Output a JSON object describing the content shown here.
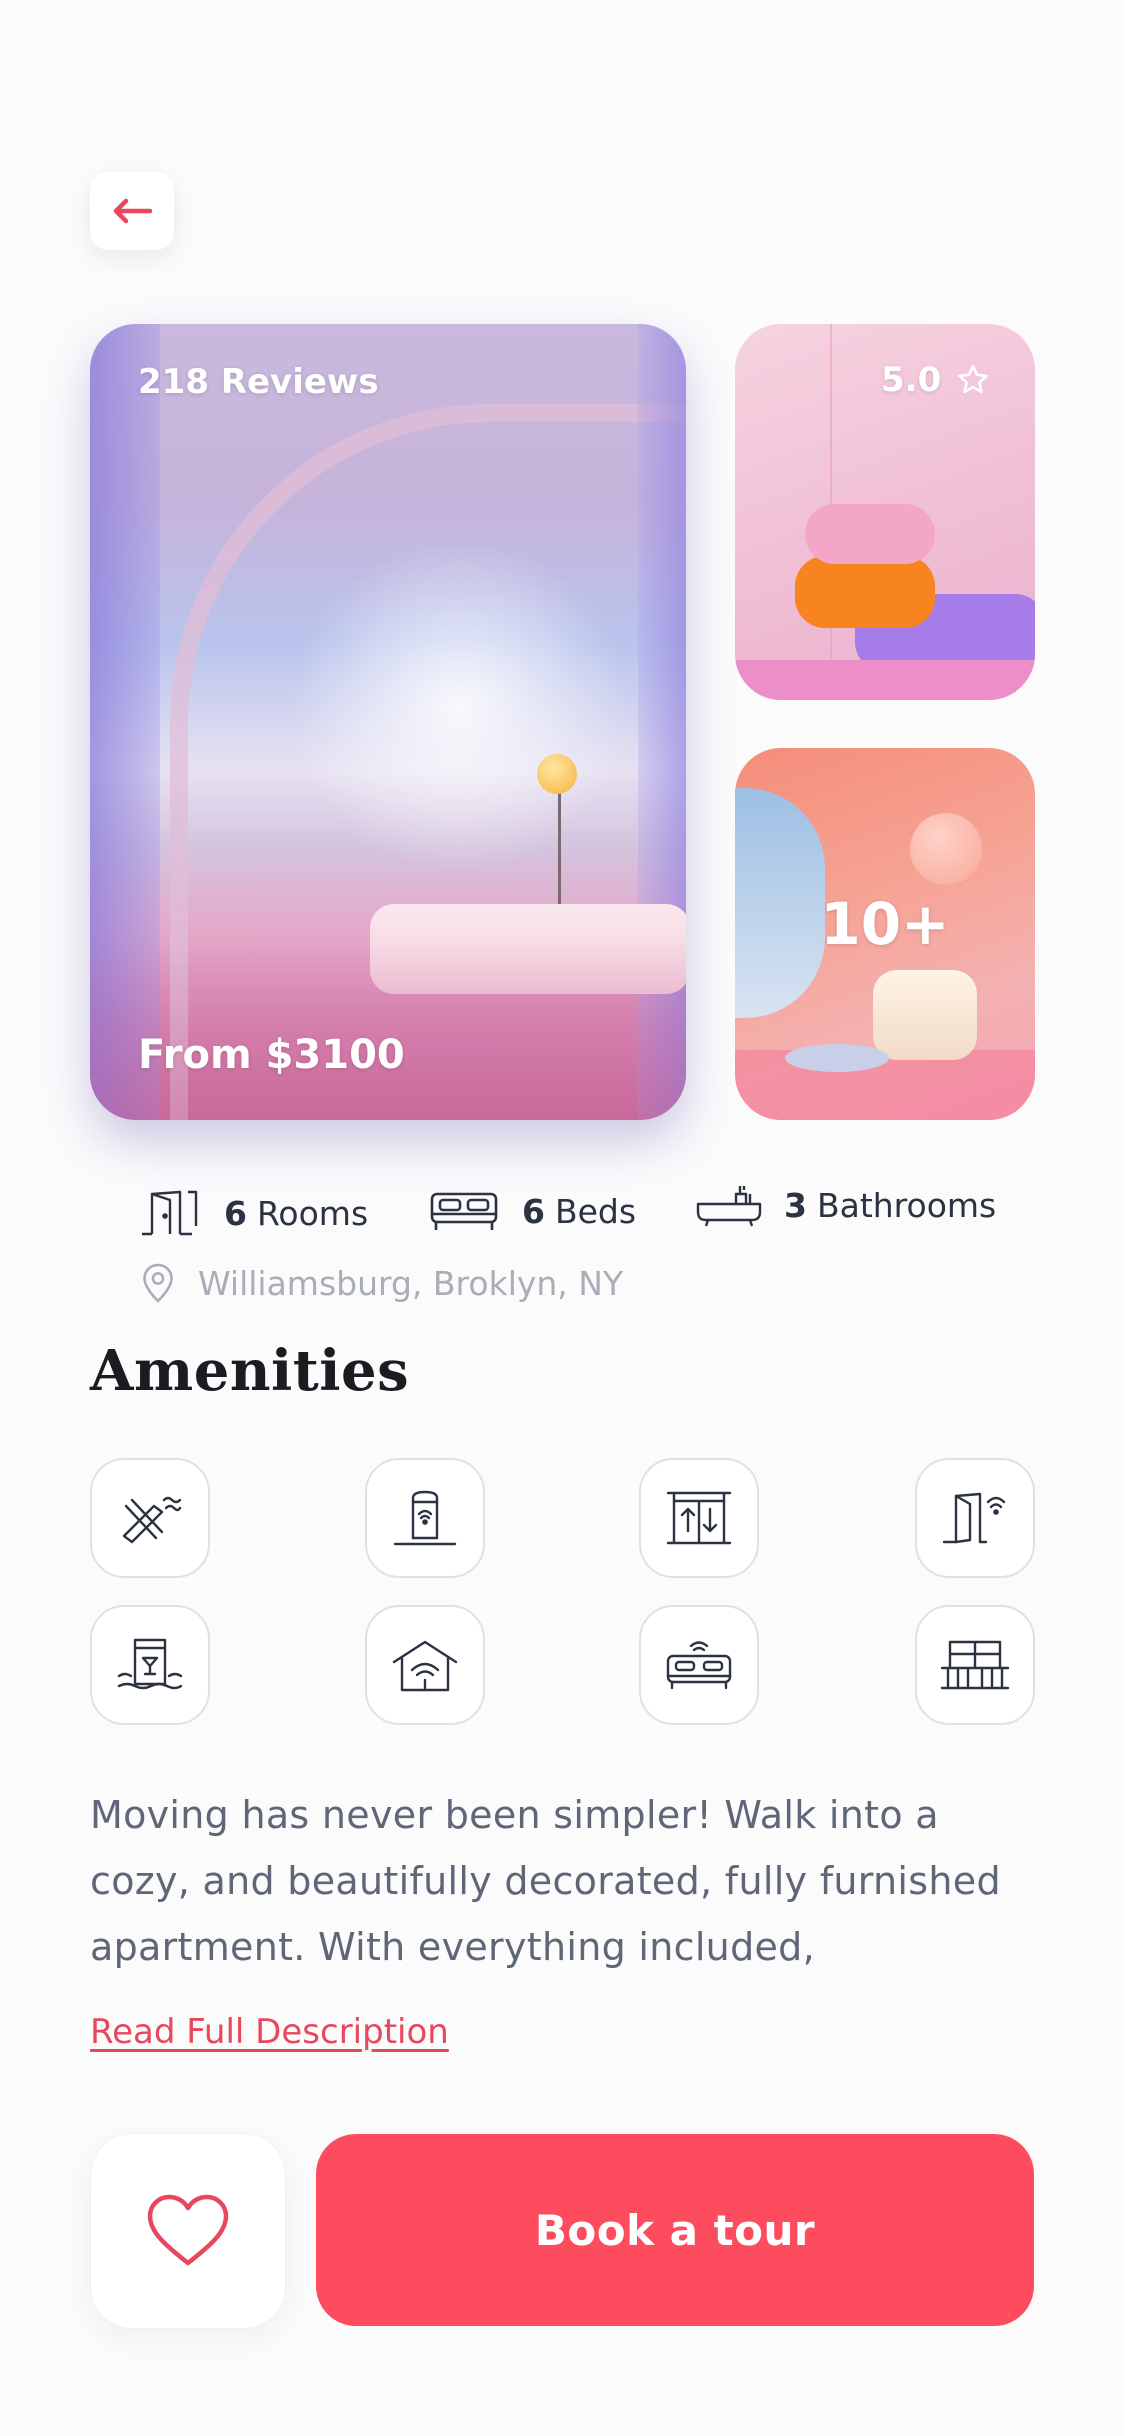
{
  "header": {
    "back_icon": "arrow-left-icon",
    "accent_color": "#e8485e"
  },
  "gallery": {
    "main": {
      "reviews_label": "218 Reviews",
      "price_label": "From $3100"
    },
    "side_top": {
      "rating": "5.0",
      "rating_icon": "star-outline-icon"
    },
    "side_bottom": {
      "more_label": "10+"
    }
  },
  "stats": {
    "rooms": {
      "value": "6",
      "label": "Rooms",
      "icon": "door-icon"
    },
    "beds": {
      "value": "6",
      "label": "Beds",
      "icon": "bed-icon"
    },
    "bathrooms": {
      "value": "3",
      "label": "Bathrooms",
      "icon": "bathtub-icon"
    }
  },
  "location": {
    "text": "Williamsburg, Broklyn, NY",
    "icon": "location-pin-icon"
  },
  "amenities": {
    "title": "Amenities",
    "items": [
      {
        "icon": "air-conditioning-icon"
      },
      {
        "icon": "smart-speaker-icon"
      },
      {
        "icon": "elevator-icon"
      },
      {
        "icon": "smart-lock-door-icon"
      },
      {
        "icon": "pool-icon"
      },
      {
        "icon": "home-wifi-icon"
      },
      {
        "icon": "smart-bed-icon"
      },
      {
        "icon": "balcony-icon"
      }
    ]
  },
  "description": {
    "text": "Moving has never been simpler! Walk into a cozy, and beautifully decorated, fully furnished apartment. With everything included,",
    "read_more": "Read Full Description"
  },
  "actions": {
    "favorite_icon": "heart-outline-icon",
    "book_label": "Book a tour",
    "book_color": "#fe4c5f"
  }
}
